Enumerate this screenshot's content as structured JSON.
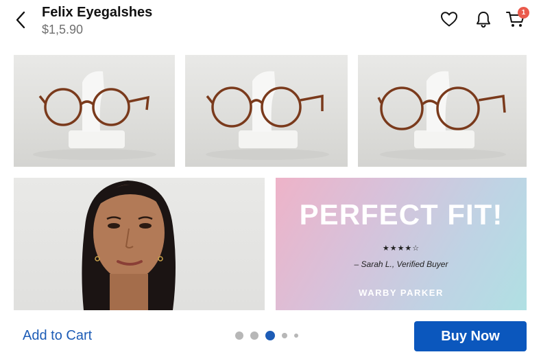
{
  "header": {
    "title": "Felix Eyegalshes",
    "price": "$1,5.90",
    "back_icon": "chevron-left-icon",
    "icons": [
      "heart-icon",
      "bell-icon",
      "cart-icon"
    ],
    "cart_badge": "1"
  },
  "gallery": {
    "active_index": 2,
    "dot_count": 5
  },
  "promo": {
    "headline": "PERFECT FIT!",
    "stars": "★★★★☆",
    "quote": "– Sarah L., Verified Buyer",
    "brand": "WARBY PARKER"
  },
  "actions": {
    "add_to_cart_label": "Add to Cart",
    "buy_now_label": "Buy Now"
  },
  "colors": {
    "accent": "#0b57bd",
    "link": "#1d5cb6",
    "badge": "#ea5a4c",
    "frame": "#7a3a1c"
  }
}
